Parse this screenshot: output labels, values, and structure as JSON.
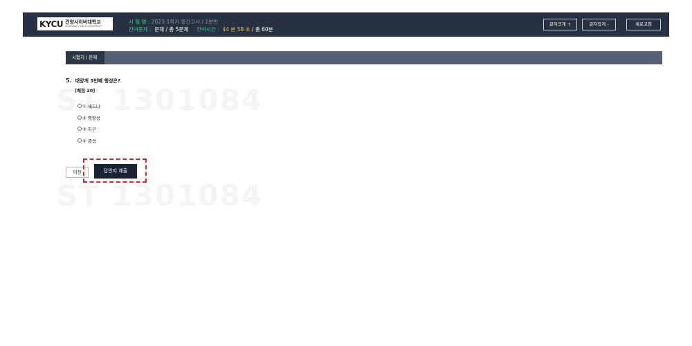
{
  "header": {
    "logo": {
      "mark": "KYCU",
      "name_ko": "건양사이버대학교",
      "name_en": "KONYANG CYBER UNIVERSITY"
    },
    "exam_name_label": "시 험 명 :",
    "exam_name_value": "2023-1학기 중간고사 / 1분반",
    "remaining_q_label": "잔여문제 :",
    "remaining_q_value": "문제 / 총 5문제",
    "remaining_time_label": "잔여시간 :",
    "remaining_time_value": "44 분 58 초",
    "total_time": "/ 총 60분",
    "buttons": {
      "font_up": "글자크게 +",
      "font_down": "글자작게 -",
      "refresh": "새로고침"
    }
  },
  "tab": {
    "label": "시험지 / 문제"
  },
  "question": {
    "number": "5.",
    "text": "태양계 3번째 행성은?",
    "score": "[배점 20]",
    "options": [
      {
        "label": "① 세드나"
      },
      {
        "label": "② 명왕성"
      },
      {
        "label": "③ 지구"
      },
      {
        "label": "④ 금성"
      }
    ]
  },
  "watermark": {
    "text": "ST 1301084"
  },
  "actions": {
    "prev": "이전",
    "submit": "답안지 제출"
  },
  "colors": {
    "header_bg": "#283141",
    "tab_active": "#2c3646",
    "tab_bar": "#556072",
    "label_green": "#3cc88c",
    "highlight": "#d8262c"
  }
}
